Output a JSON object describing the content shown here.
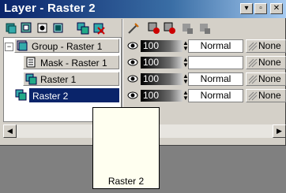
{
  "window": {
    "title": "Layer - Raster 2",
    "buttons": {
      "menu": "▾",
      "restore": "▫",
      "close": "✕"
    }
  },
  "toolbar": {
    "icons": [
      "new-raster-layer-icon",
      "new-vector-layer-icon",
      "new-mask-icon",
      "new-adjustment-layer-icon",
      "duplicate-layer-icon",
      "delete-layer-icon",
      "edit-selection-icon",
      "visibility-toggle-icon",
      "link-toggle-icon",
      "lock-icon",
      "lock-all-icon"
    ]
  },
  "layers": [
    {
      "name": "Group - Raster 1",
      "type": "group",
      "indent": 0,
      "selected": false
    },
    {
      "name": "Mask - Raster 1",
      "type": "mask",
      "indent": 1,
      "selected": false
    },
    {
      "name": "Raster 1",
      "type": "raster",
      "indent": 1,
      "selected": false
    },
    {
      "name": "Raster 2",
      "type": "raster",
      "indent": 0,
      "selected": true
    }
  ],
  "properties": [
    {
      "opacity": "100",
      "blend": "Normal",
      "lock": "None"
    },
    {
      "opacity": "100",
      "blend": "",
      "lock": "None"
    },
    {
      "opacity": "100",
      "blend": "Normal",
      "lock": "None"
    },
    {
      "opacity": "100",
      "blend": "Normal",
      "lock": "None"
    }
  ],
  "tooltip": {
    "label": "Raster 2"
  },
  "colors": {
    "title_start": "#0a246a",
    "title_end": "#a6caf0",
    "selection": "#0a246a"
  }
}
